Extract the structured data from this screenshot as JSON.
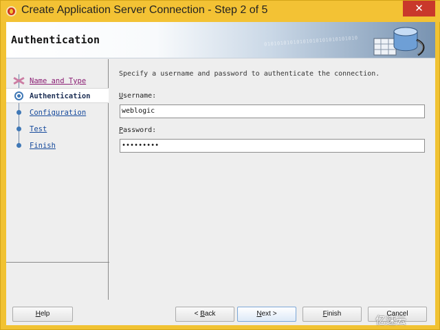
{
  "window": {
    "title": "Create Application Server Connection - Step 2 of 5",
    "close_glyph": "✕",
    "titlebar_color": "#f3c234"
  },
  "banner": {
    "title": "Authentication",
    "binary_text": "01010101010101010101010101010"
  },
  "steps": [
    {
      "label": "Name and Type",
      "state": "visited"
    },
    {
      "label": "Authentication",
      "state": "active"
    },
    {
      "label": "Configuration",
      "state": "pending"
    },
    {
      "label": "Test",
      "state": "pending"
    },
    {
      "label": "Finish",
      "state": "pending"
    }
  ],
  "form": {
    "instruction": "Specify a username and password to authenticate the connection.",
    "username_label": "Username:",
    "username_mnemonic": "U",
    "username_rest": "sername:",
    "username_value": "weblogic",
    "password_label": "Password:",
    "password_mnemonic": "P",
    "password_rest": "assword:",
    "password_value": "•••••••••"
  },
  "buttons": {
    "help": {
      "mnemonic": "H",
      "rest": "elp"
    },
    "back": {
      "prefix": "< ",
      "mnemonic": "B",
      "rest": "ack"
    },
    "next": {
      "mnemonic": "N",
      "rest": "ext",
      "suffix": " >"
    },
    "finish": {
      "mnemonic": "F",
      "rest": "inish"
    },
    "cancel_partial": "Cancel"
  },
  "watermark": "亿速云",
  "colors": {
    "link": "#13489b",
    "visited_link": "#8a1d73",
    "accent": "#3f78b6",
    "close_button": "#c9382b"
  },
  "icons": {
    "app": "oracle-jdeveloper-icon",
    "close": "close-icon",
    "banner": "server-database-icon",
    "watermark": "cloud-logo-icon"
  }
}
